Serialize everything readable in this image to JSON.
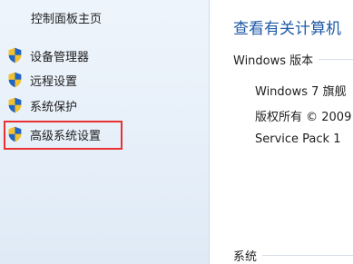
{
  "sidebar": {
    "home_label": "控制面板主页",
    "tasks": [
      {
        "label": "设备管理器",
        "icon": "uac-shield-icon"
      },
      {
        "label": "远程设置",
        "icon": "uac-shield-icon"
      },
      {
        "label": "系统保护",
        "icon": "uac-shield-icon"
      },
      {
        "label": "高级系统设置",
        "icon": "uac-shield-icon",
        "highlighted": true
      }
    ]
  },
  "main": {
    "title": "查看有关计算机",
    "edition_section": {
      "heading": "Windows 版本",
      "lines": [
        "Windows 7 旗舰",
        "版权所有 © 2009",
        "Service Pack 1"
      ]
    },
    "system_section": {
      "heading": "系统"
    }
  },
  "colors": {
    "title": "#1e5aa8",
    "highlight_border": "#e8322f",
    "sidebar_bg": "#e6eff9"
  }
}
